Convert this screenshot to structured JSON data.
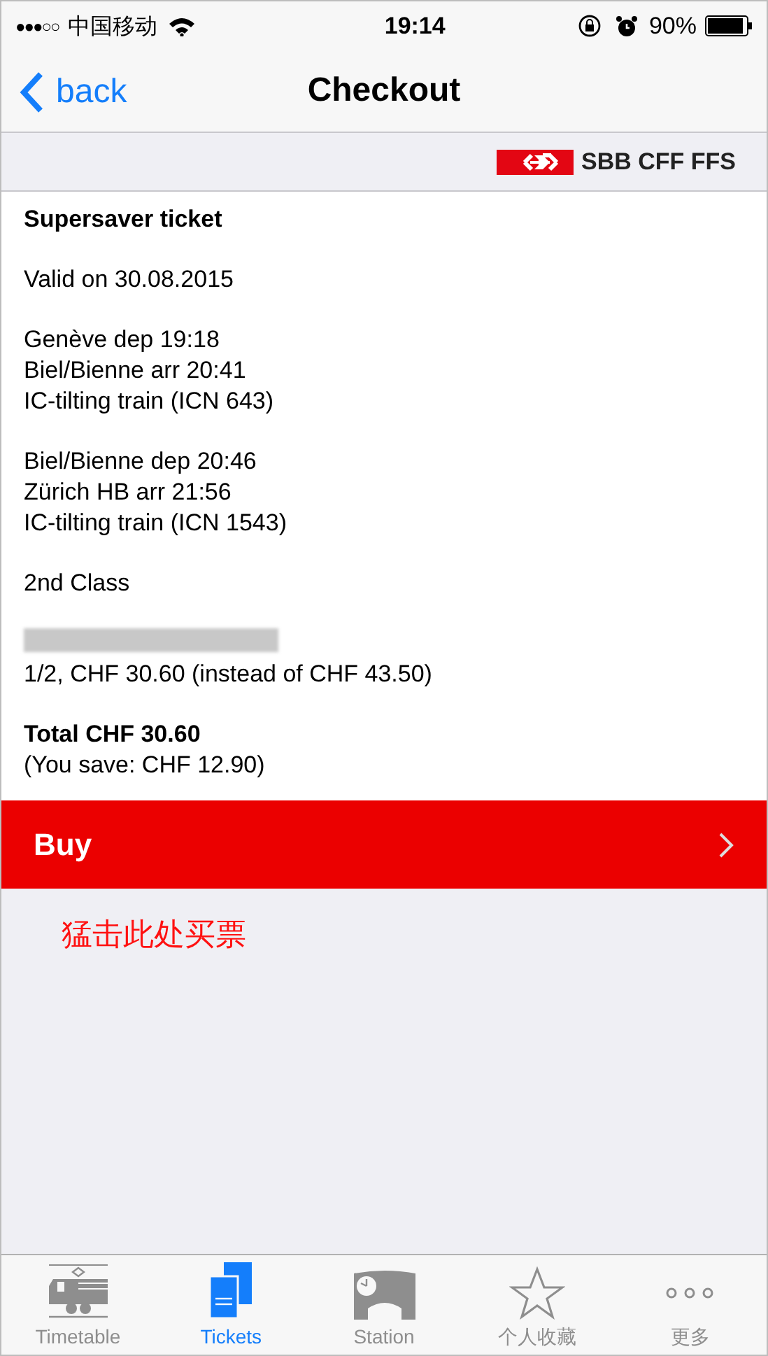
{
  "status_bar": {
    "signal": "●●●○○",
    "carrier": "中国移动",
    "time": "19:14",
    "battery": "90%"
  },
  "nav": {
    "back": "back",
    "title": "Checkout"
  },
  "brand": {
    "name": "SBB CFF FFS"
  },
  "ticket": {
    "title": "Supersaver ticket",
    "blocks": [
      [
        "Valid on 30.08.2015"
      ],
      [
        "Genève dep 19:18",
        "Biel/Bienne arr 20:41",
        "IC-tilting train (ICN 643)"
      ],
      [
        "Biel/Bienne dep 20:46",
        "Zürich HB arr 21:56",
        "IC-tilting train (ICN 1543)"
      ],
      [
        "2nd Class"
      ]
    ],
    "redacted": true,
    "fare": "1/2, CHF 30.60 (instead of CHF 43.50)",
    "total": "Total CHF 30.60",
    "saving": "(You save: CHF 12.90)"
  },
  "buy_button": {
    "label": "Buy"
  },
  "annotation": "猛击此处买票",
  "tab_bar": [
    {
      "kind": "train",
      "label": "Timetable",
      "selected": false
    },
    {
      "kind": "tickets",
      "label": "Tickets",
      "selected": true
    },
    {
      "kind": "station",
      "label": "Station",
      "selected": false
    },
    {
      "kind": "star",
      "label": "个人收藏",
      "selected": false
    },
    {
      "kind": "more",
      "label": "更多",
      "selected": false
    }
  ]
}
